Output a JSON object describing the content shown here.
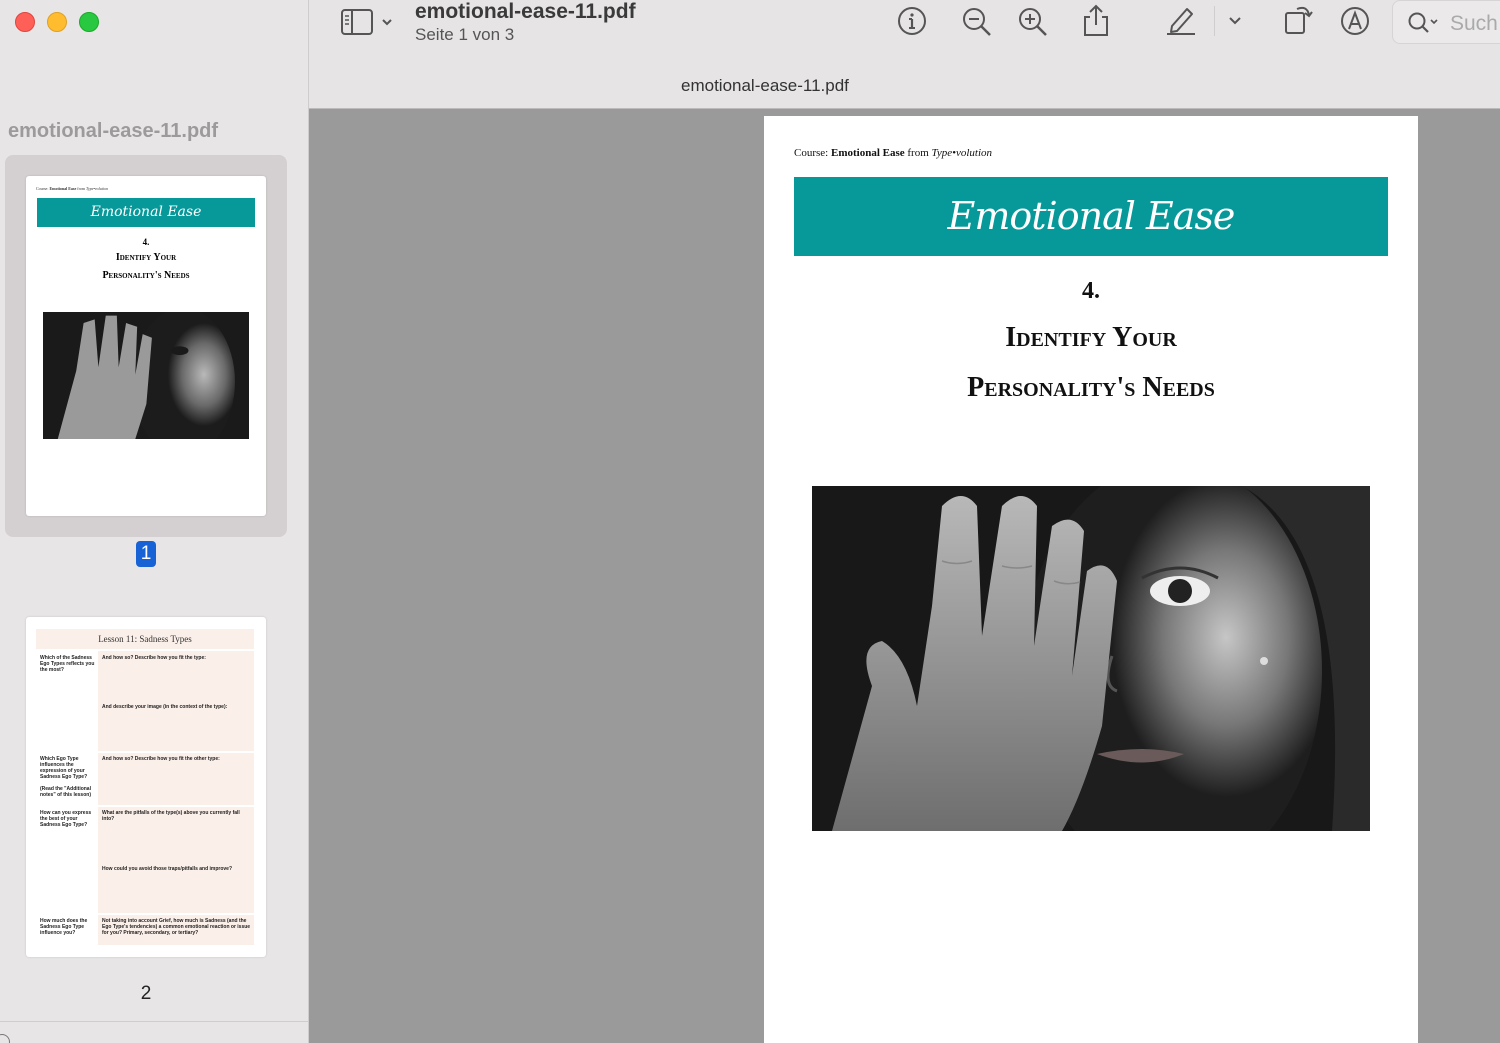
{
  "window": {
    "doc_title": "emotional-ease-11.pdf",
    "page_status": "Seite 1 von 3",
    "doc_tab": "emotional-ease-11.pdf"
  },
  "search": {
    "placeholder": "Such"
  },
  "sidebar": {
    "title": "emotional-ease-11.pdf",
    "pages": [
      {
        "number": "1",
        "selected": true
      },
      {
        "number": "2",
        "selected": false
      }
    ]
  },
  "thumb2": {
    "header": "Lesson 11: Sadness Types",
    "rows": [
      {
        "q": "Which of the Sadness Ego Types reflects you the most?",
        "a1": "And how so? Describe how you fit the type:",
        "a2": "And describe your image (in the context of the type):"
      },
      {
        "q": "Which Ego Type influences the expression of your Sadness Ego Type?",
        "q2": "(Read the \"Additional notes\" of this lesson)",
        "a1": "And how so? Describe how you fit the other type:"
      },
      {
        "q": "How can you express the best of your Sadness Ego Type?",
        "a1": "What are the pitfalls of the type(s) above you currently fall into?",
        "a2": "How could you avoid those traps/pitfalls and improve?"
      },
      {
        "q": "How much does the Sadness Ego Type influence you?",
        "a1": "Not taking into account Grief, how much is Sadness (and the Ego Type's tendencies) a common emotional reaction or issue for you? Primary, secondary, or tertiary?"
      }
    ]
  },
  "page": {
    "course_prefix": "Course:",
    "course_name": "Emotional Ease",
    "course_from": "from",
    "course_brand": "Type•volution",
    "banner_title": "Emotional Ease",
    "lesson_number": "4.",
    "heading_line1": "Identify Your",
    "heading_line2": "Personality's Needs"
  },
  "colors": {
    "teal": "#07999a",
    "accent_blue": "#1763d6"
  }
}
